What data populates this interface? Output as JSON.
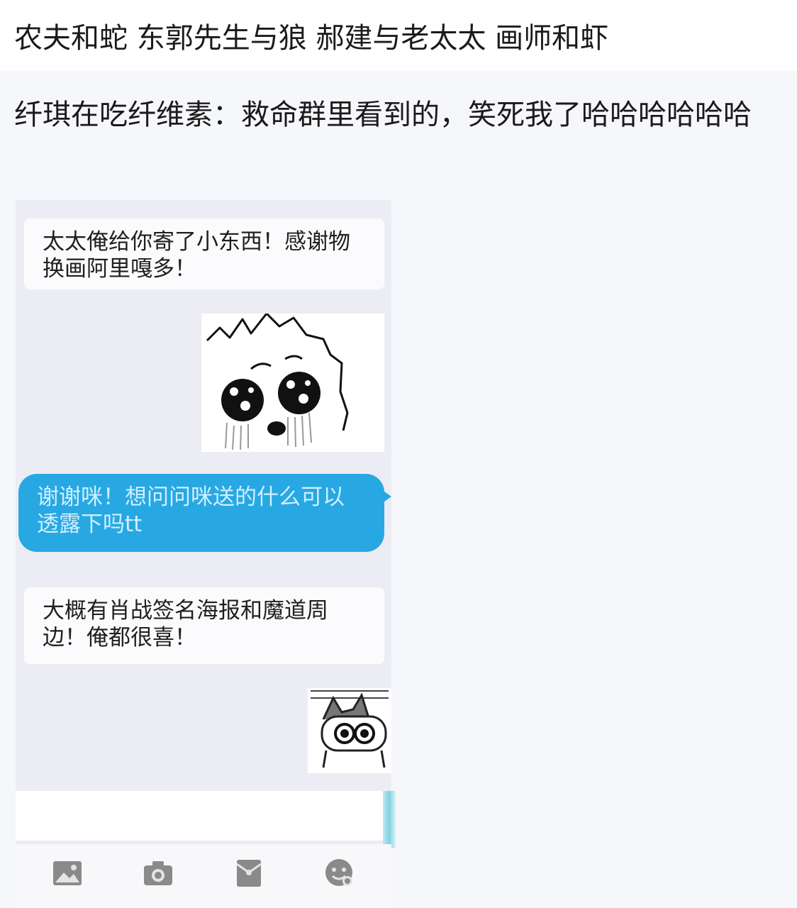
{
  "header": {
    "title": "农夫和蛇  东郭先生与狼 郝建与老太太 画师和虾"
  },
  "post": {
    "text": "纤琪在吃纤维素：救命群里看到的，笑死我了哈哈哈哈哈哈"
  },
  "chat": {
    "messages": [
      {
        "side": "incoming",
        "text": "太太俺给你寄了小东西！感谢物换画阿里嘎多！"
      },
      {
        "side": "incoming",
        "sticker": "crying-dog-sticker"
      },
      {
        "side": "outgoing",
        "text": "谢谢咪！想问问咪送的什么可以透露下吗tt"
      },
      {
        "side": "incoming",
        "text": "大概有肖战签名海报和魔道周边！俺都很喜！"
      },
      {
        "side": "incoming",
        "sticker": "peeking-cat-sticker"
      }
    ],
    "toolbar": [
      {
        "icon": "image-icon"
      },
      {
        "icon": "camera-icon"
      },
      {
        "icon": "red-envelope-icon"
      },
      {
        "icon": "emoji-icon"
      }
    ]
  },
  "colors": {
    "outgoing_bubble": "#27a8e3",
    "incoming_bubble": "#fbfbfd",
    "toolbar_icon": "#8a8a8a"
  }
}
